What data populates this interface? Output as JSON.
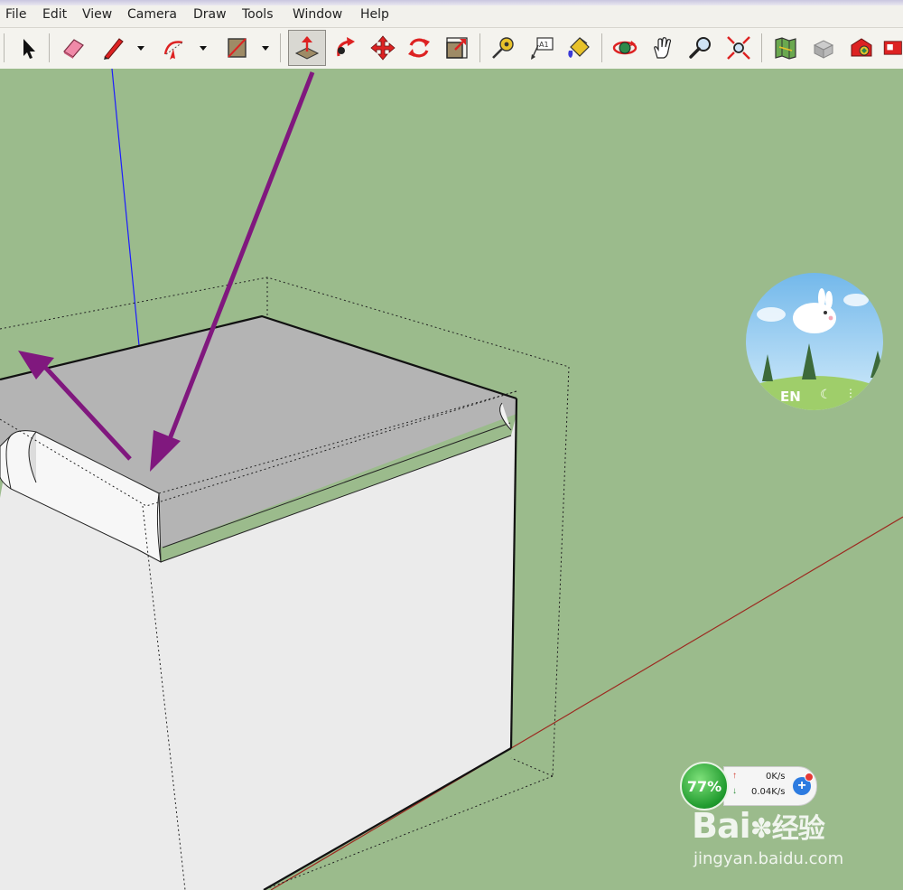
{
  "menubar": {
    "items": [
      "File",
      "Edit",
      "View",
      "Camera",
      "Draw",
      "Tools",
      "Window",
      "Help"
    ]
  },
  "toolbar": {
    "tools": [
      "select-arrow-icon",
      "eraser-icon",
      "pencil-line-icon",
      "arc-icon",
      "rectangle-icon",
      "push-pull-icon",
      "follow-me-icon",
      "move-icon",
      "rotate-icon",
      "scale-icon",
      "tape-measure-icon",
      "text-label-icon",
      "paint-bucket-icon",
      "orbit-icon",
      "pan-hand-icon",
      "zoom-magnifier-icon",
      "zoom-extents-icon",
      "map-icon",
      "components-icon",
      "warehouse-icon"
    ],
    "active_tool": "push-pull-icon"
  },
  "colors": {
    "viewport_bg": "#9bbb8c",
    "annotation_arrow": "#80187e",
    "axis_blue": "#1c1cff",
    "axis_red": "#9c2a20",
    "axis_green": "#1b6e1b",
    "box_top": "#b4b4b4",
    "box_side": "#ebebeb"
  },
  "ime_widget": {
    "label": "EN",
    "icons": [
      "moon-icon",
      "dots-icon"
    ]
  },
  "speed_widget": {
    "percent": "77%",
    "upload": "0K/s",
    "download": "0.04K/s"
  },
  "watermark": {
    "brand": "Bai",
    "brand_cn": "经验",
    "url": "jingyan.baidu.com"
  }
}
